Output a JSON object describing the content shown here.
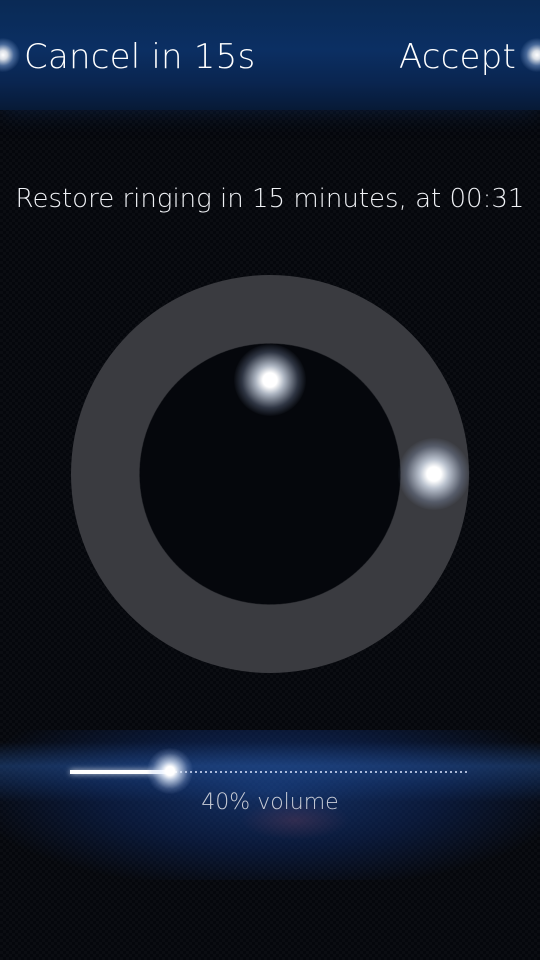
{
  "header": {
    "cancel_label": "Cancel in 15s",
    "accept_label": "Accept"
  },
  "info": {
    "text": "Restore ringing in 15 minutes, at 00:31"
  },
  "dial": {
    "minutes": 15
  },
  "volume": {
    "label": "40% volume",
    "level": 0.4
  },
  "colors": {
    "header_blue": "#0b2f63",
    "background": "#05070c",
    "ring": "#3a3b40",
    "accent_glow": "#ffffff"
  }
}
